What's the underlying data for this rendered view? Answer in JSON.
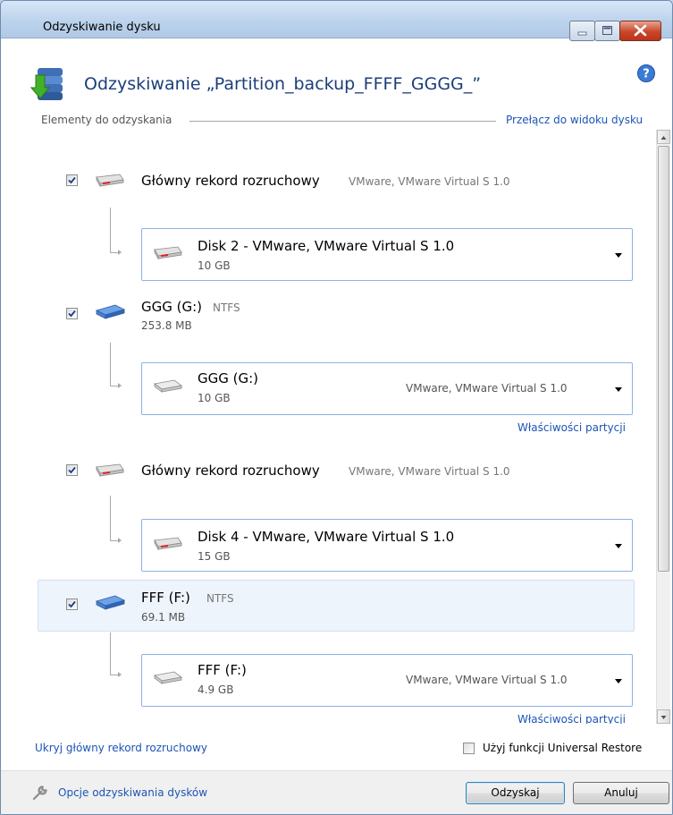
{
  "window": {
    "title": "Odzyskiwanie dysku",
    "header_title": "Odzyskiwanie „Partition_backup_FFFF_GGGG_”"
  },
  "section": {
    "label": "Elementy do odzyskania",
    "switch_link": "Przełącz do widoku dysku"
  },
  "items": [
    {
      "title": "Główny rekord rozruchowy",
      "subtitle": "VMware, VMware Virtual S 1.0",
      "checked": true,
      "target": {
        "title": "Disk 2 - VMware, VMware Virtual S 1.0",
        "size": "10 GB"
      }
    },
    {
      "title": "GGG (G:)",
      "subtitle": "NTFS",
      "size": "253.8 MB",
      "checked": true,
      "target": {
        "title": "GGG (G:)",
        "size": "10 GB",
        "device": "VMware, VMware Virtual S 1.0"
      },
      "props_link": "Właściwości partycji"
    },
    {
      "title": "Główny rekord rozruchowy",
      "subtitle": "VMware, VMware Virtual S 1.0",
      "checked": true,
      "target": {
        "title": "Disk 4 - VMware, VMware Virtual S 1.0",
        "size": "15 GB"
      }
    },
    {
      "title": "FFF (F:)",
      "subtitle": "NTFS",
      "size": "69.1 MB",
      "checked": true,
      "selected": true,
      "target": {
        "title": "FFF (F:)",
        "size": "4.9 GB",
        "device": "VMware, VMware Virtual S 1.0"
      },
      "props_link": "Właściwości partycji"
    }
  ],
  "bottom": {
    "hide_mbr_link": "Ukryj główny rekord rozruchowy",
    "universal_restore_label": "Użyj funkcji Universal Restore",
    "universal_restore_checked": false
  },
  "footer": {
    "options_link": "Opcje odzyskiwania dysków",
    "ok_label": "Odzyskaj",
    "cancel_label": "Anuluj"
  },
  "colors": {
    "link": "#1c55b5",
    "header_title": "#1c3e7a",
    "selection": "#eef4fb"
  },
  "icons": {
    "header": "disk-recovery-icon",
    "help": "help-icon",
    "mbr": "hard-disk-icon",
    "volume": "volume-icon",
    "options": "wrench-icon"
  }
}
